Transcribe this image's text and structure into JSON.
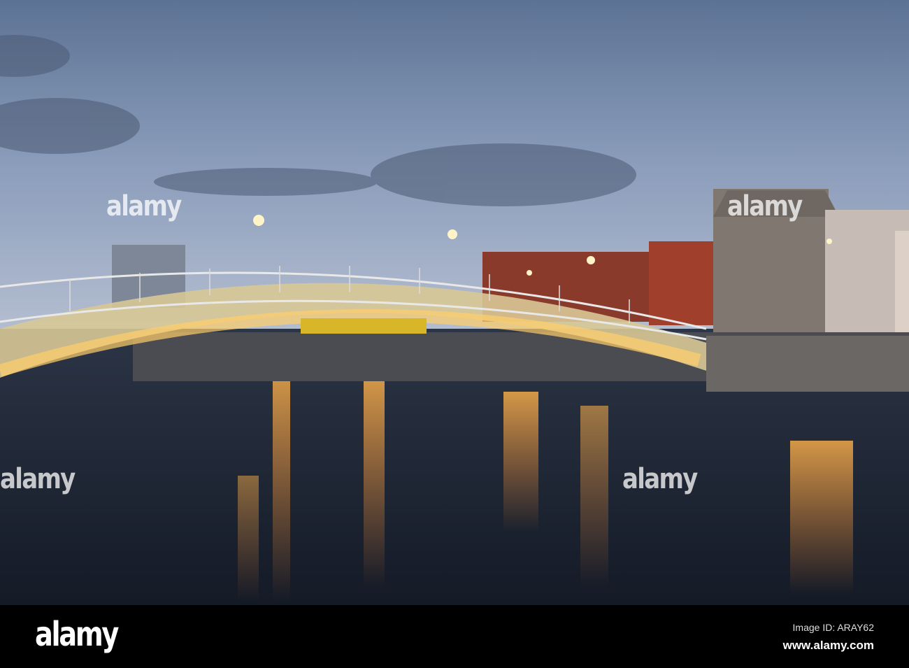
{
  "photo": {
    "subject": "Ha'penny Bridge over the River Liffey at dusk",
    "colors": {
      "sky_top": "#5f7595",
      "sky_bottom": "#aab6cc",
      "water": "#1c2433",
      "brick": "#a0402c",
      "stone": "#8a7f78",
      "light": "#ffcf6a"
    }
  },
  "watermark": {
    "text": "alamy"
  },
  "footer": {
    "logo": "alamy",
    "image_id": "Image ID: ARAY62",
    "url": "www.alamy.com"
  }
}
